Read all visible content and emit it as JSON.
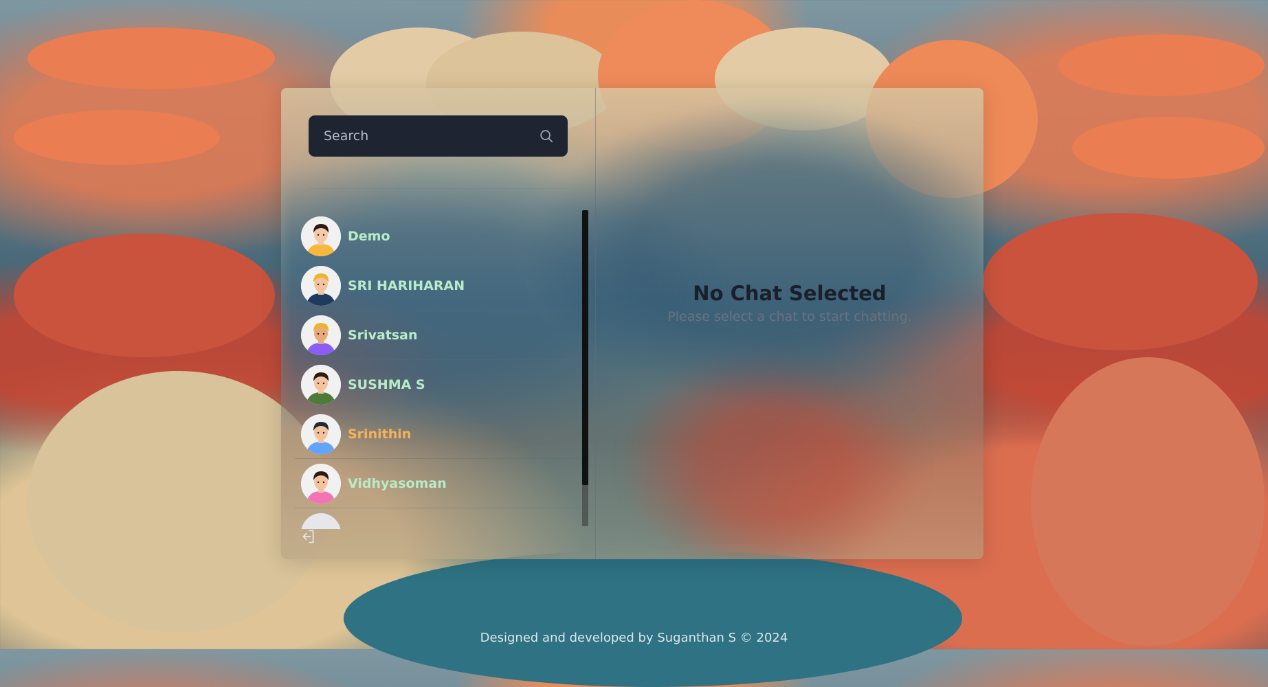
{
  "search": {
    "placeholder": "Search"
  },
  "contacts": [
    {
      "name": "Demo",
      "color": "#b8ecc8",
      "avatar": {
        "skin": "#f4c9a8",
        "hair": "#2b1a14",
        "shirt": "#f6b93b"
      }
    },
    {
      "name": "SRI HARIHARAN",
      "color": "#b8ecc8",
      "avatar": {
        "skin": "#f2c39c",
        "hair": "#f0b429",
        "shirt": "#1e3a5f"
      }
    },
    {
      "name": "Srivatsan",
      "color": "#b8ecc8",
      "avatar": {
        "skin": "#e8a97b",
        "hair": "#f0b429",
        "shirt": "#8b5cf6"
      }
    },
    {
      "name": "SUSHMA S",
      "color": "#b8ecc8",
      "avatar": {
        "skin": "#f2c39c",
        "hair": "#2b1a14",
        "shirt": "#4d7c3a"
      }
    },
    {
      "name": "Srinithin",
      "color": "#f3b35a",
      "avatar": {
        "skin": "#f2c39c",
        "hair": "#1f2937",
        "shirt": "#60a5fa"
      }
    },
    {
      "name": "Vidhyasoman",
      "color": "#b8ecc8",
      "avatar": {
        "skin": "#f2c39c",
        "hair": "#2b1a14",
        "shirt": "#f472b6"
      }
    }
  ],
  "main": {
    "title": "No Chat Selected",
    "subtitle": "Please select a chat to start chatting."
  },
  "footer": "Designed and developed by Suganthan S © 2024"
}
